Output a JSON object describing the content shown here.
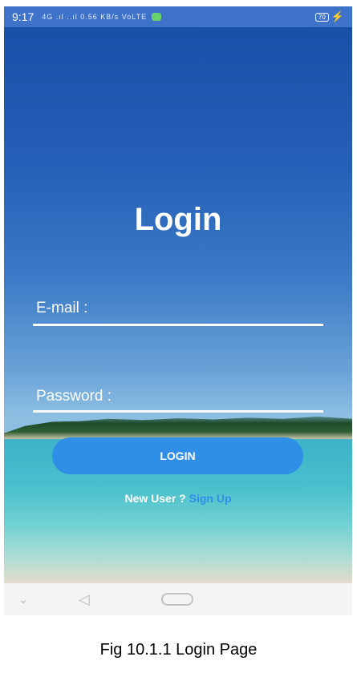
{
  "status_bar": {
    "time": "9:17",
    "signal_text": "4G .ıl ..ıl 0.56 KB/s VoLTE",
    "battery": "70"
  },
  "login": {
    "title": "Login",
    "email_label": "E-mail :",
    "password_label": "Password :",
    "button_label": "LOGIN",
    "new_user_text": "New User ?",
    "signup_link": "Sign Up"
  },
  "caption": "Fig 10.1.1 Login Page",
  "colors": {
    "accent": "#2f8fe6",
    "status_bar": "#3f73c9"
  }
}
